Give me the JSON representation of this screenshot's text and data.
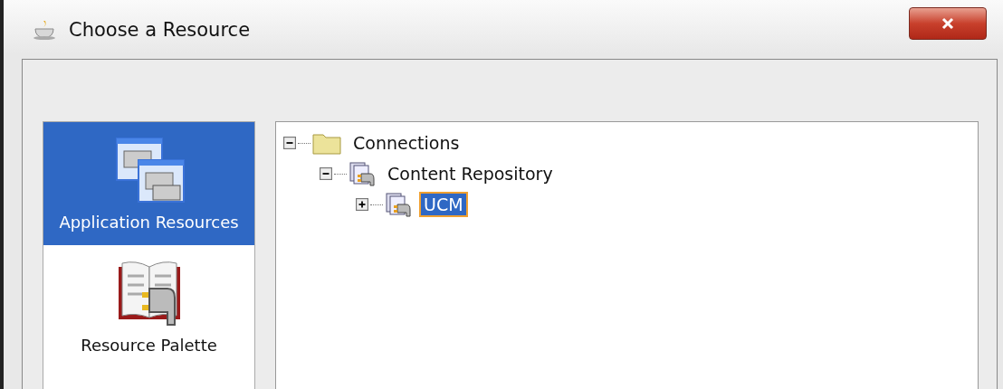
{
  "window": {
    "title": "Choose a Resource"
  },
  "sidebar": {
    "items": [
      {
        "label": "Application Resources",
        "kind": "windows",
        "selected": true
      },
      {
        "label": "Resource Palette",
        "kind": "book",
        "selected": false
      }
    ]
  },
  "tree": [
    {
      "label": "Connections",
      "kind": "folder",
      "expanded": true,
      "selected": false,
      "children": [
        {
          "label": "Content Repository",
          "kind": "connection",
          "expanded": true,
          "selected": false,
          "children": [
            {
              "label": "UCM",
              "kind": "connection",
              "expanded": false,
              "selected": true
            }
          ]
        }
      ]
    }
  ]
}
